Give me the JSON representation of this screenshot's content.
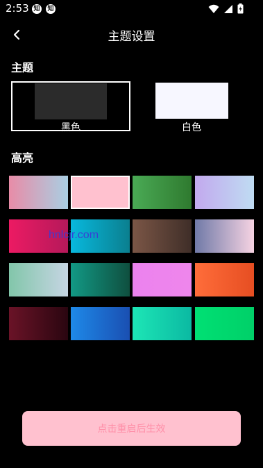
{
  "status_bar": {
    "time": "2:53",
    "notification_badges": [
      "知",
      "知"
    ]
  },
  "header": {
    "title": "主题设置"
  },
  "theme_section": {
    "label": "主题",
    "options": [
      {
        "name": "黑色",
        "selected": true,
        "preview_color": "#2b2b2b"
      },
      {
        "name": "白色",
        "selected": false,
        "preview_color": "#f7f7ff"
      }
    ]
  },
  "highlight_section": {
    "label": "高亮",
    "swatches": [
      {
        "from": "#e88ca7",
        "to": "#a9cfe3",
        "selected": false
      },
      {
        "from": "#ffc1cf",
        "to": "#ffc1cf",
        "selected": true
      },
      {
        "from": "#4aaa55",
        "to": "#2f7a2f",
        "selected": false
      },
      {
        "from": "#c2a9ee",
        "to": "#bfdcf2",
        "selected": false
      },
      {
        "from": "#ec1a63",
        "to": "#b5195a",
        "selected": false
      },
      {
        "from": "#08b8dd",
        "to": "#0a7f8f",
        "selected": false
      },
      {
        "from": "#7b5646",
        "to": "#3f2e28",
        "selected": false
      },
      {
        "from": "#707aa8",
        "to": "#f6d3e2",
        "selected": false
      },
      {
        "from": "#82c6aa",
        "to": "#c6d5e3",
        "selected": false
      },
      {
        "from": "#129985",
        "to": "#0f4f3f",
        "selected": false
      },
      {
        "from": "#ec82ee",
        "to": "#ee86ec",
        "selected": false
      },
      {
        "from": "#ff6d3a",
        "to": "#e64e22",
        "selected": false
      },
      {
        "from": "#6a1327",
        "to": "#2a0610",
        "selected": false
      },
      {
        "from": "#1e89e8",
        "to": "#1a4fb2",
        "selected": false
      },
      {
        "from": "#1de6b6",
        "to": "#0bb9a2",
        "selected": false
      },
      {
        "from": "#00e074",
        "to": "#00d068",
        "selected": false
      }
    ]
  },
  "watermark": "hnlcjr.com",
  "apply_button": {
    "label": "点击重启后生效"
  }
}
